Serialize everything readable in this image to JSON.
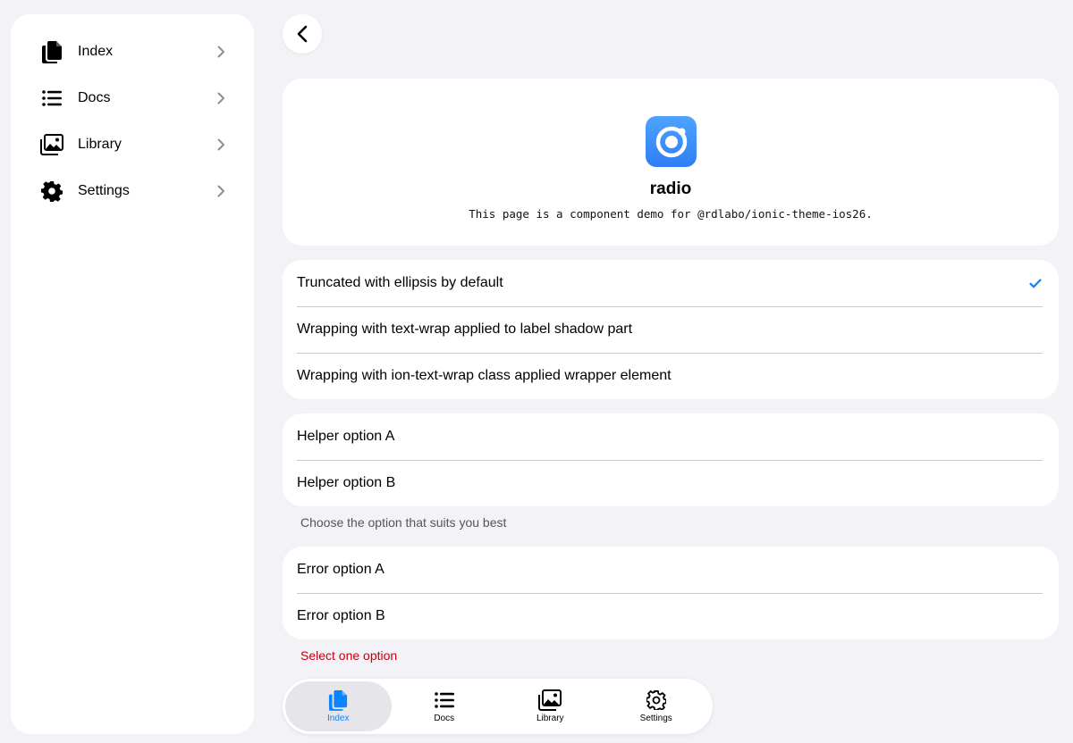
{
  "sidebar": {
    "items": [
      {
        "label": "Index",
        "icon": "documents-icon"
      },
      {
        "label": "Docs",
        "icon": "list-icon"
      },
      {
        "label": "Library",
        "icon": "images-icon"
      },
      {
        "label": "Settings",
        "icon": "gear-icon"
      }
    ]
  },
  "hero": {
    "title": "radio",
    "description": "This page is a component demo for @rdlabo/ionic-theme-ios26."
  },
  "group1": {
    "options": [
      "Truncated with ellipsis by default",
      "Wrapping with text-wrap applied to label shadow part",
      "Wrapping with ion-text-wrap class applied wrapper element"
    ],
    "selected_index": 0
  },
  "group2": {
    "options": [
      "Helper option A",
      "Helper option B"
    ],
    "helper_text": "Choose the option that suits you best"
  },
  "group3": {
    "options": [
      "Error option A",
      "Error option B"
    ],
    "error_text": "Select one option"
  },
  "tabbar": {
    "tabs": [
      {
        "label": "Index",
        "icon": "documents-icon",
        "active": true
      },
      {
        "label": "Docs",
        "icon": "list-icon",
        "active": false
      },
      {
        "label": "Library",
        "icon": "images-icon",
        "active": false
      },
      {
        "label": "Settings",
        "icon": "gear-icon",
        "active": false
      }
    ]
  },
  "colors": {
    "accent": "#0a84ff",
    "error": "#c5000f",
    "background": "#f2f2f7"
  }
}
